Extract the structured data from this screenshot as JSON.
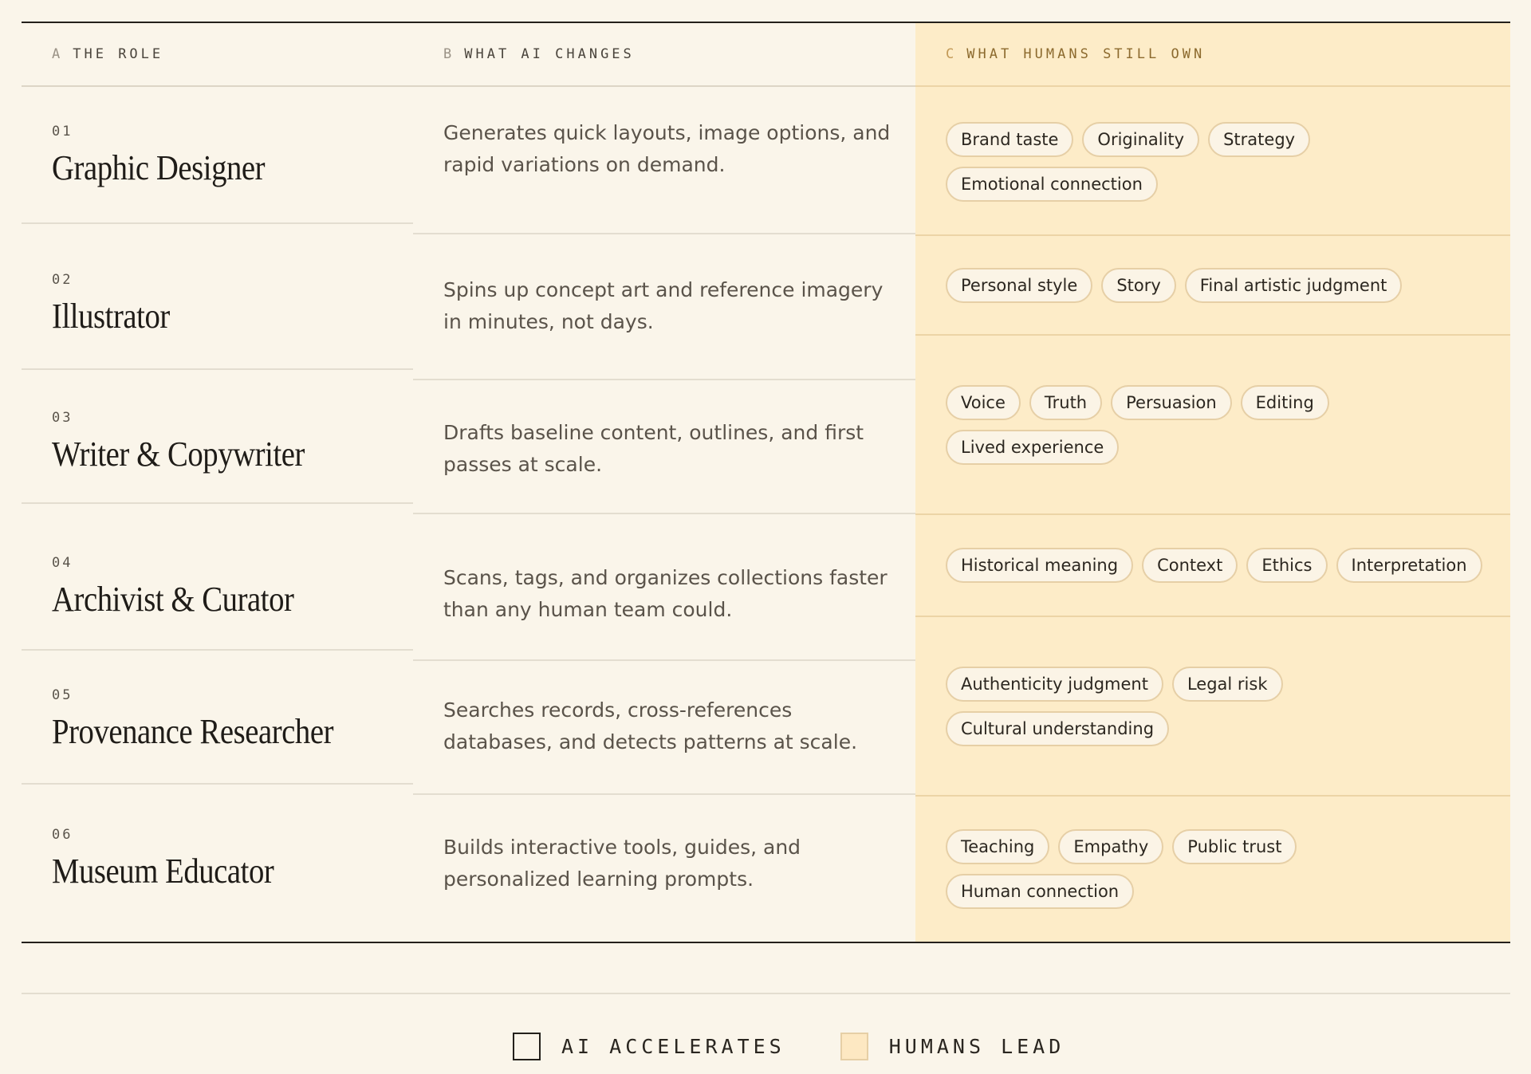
{
  "headers": {
    "a": {
      "letter": "A",
      "label": "THE ROLE"
    },
    "b": {
      "letter": "B",
      "label": "WHAT AI CHANGES"
    },
    "c": {
      "letter": "C",
      "label": "WHAT HUMANS STILL OWN"
    }
  },
  "rows": [
    {
      "num": "01",
      "role": "Graphic Designer",
      "ai": "Generates quick layouts, image options, and rapid variations on demand.",
      "tags": [
        "Brand taste",
        "Originality",
        "Strategy",
        "Emotional connection"
      ]
    },
    {
      "num": "02",
      "role": "Illustrator",
      "ai": "Spins up concept art and reference imagery in minutes, not days.",
      "tags": [
        "Personal style",
        "Story",
        "Final artistic judgment"
      ]
    },
    {
      "num": "03",
      "role": "Writer & Copywriter",
      "ai": "Drafts baseline content, outlines, and first passes at scale.",
      "tags": [
        "Voice",
        "Truth",
        "Persuasion",
        "Editing",
        "Lived experience"
      ]
    },
    {
      "num": "04",
      "role": "Archivist & Curator",
      "ai": "Scans, tags, and organizes collections faster than any human team could.",
      "tags": [
        "Historical meaning",
        "Context",
        "Ethics",
        "Interpretation"
      ]
    },
    {
      "num": "05",
      "role": "Provenance Researcher",
      "ai": "Searches records, cross-references databases, and detects patterns at scale.",
      "tags": [
        "Authenticity judgment",
        "Legal risk",
        "Cultural understanding"
      ]
    },
    {
      "num": "06",
      "role": "Museum Educator",
      "ai": "Builds interactive tools, guides, and personalized learning prompts.",
      "tags": [
        "Teaching",
        "Empathy",
        "Public trust",
        "Human connection"
      ]
    }
  ],
  "legend": {
    "ai": "AI ACCELERATES",
    "humans": "HUMANS LEAD"
  },
  "colors": {
    "background": "#faf5ea",
    "humans_column": "#fdecc8",
    "tag_border": "#e6cfa6",
    "ink": "#23201b"
  }
}
